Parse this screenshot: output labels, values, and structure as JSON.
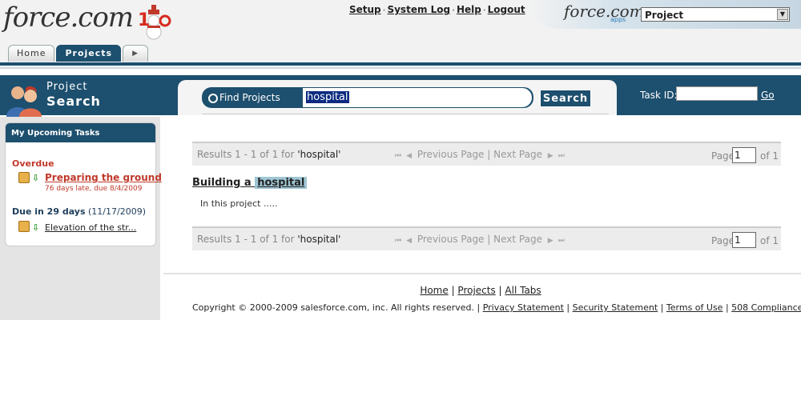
{
  "brand": {
    "logo_text": "force.com",
    "logo_suffix": "10",
    "app_logo_text": "force.com",
    "app_logo_sub": "apps"
  },
  "tabs": [
    {
      "label": "Home"
    },
    {
      "label": "Projects"
    }
  ],
  "top_links": {
    "setup": "Setup",
    "system_log": "System Log",
    "help": "Help",
    "logout": "Logout"
  },
  "app_selector": {
    "selected": "Project"
  },
  "project_search": {
    "title_line1": "Project",
    "title_line2": "Search",
    "find_label": "Find Projects",
    "query": "hospital",
    "search_button": "Search"
  },
  "task_id": {
    "label": "Task ID:",
    "value": "",
    "go_label": "Go"
  },
  "upcoming_tasks": {
    "header": "My Upcoming Tasks",
    "overdue_label": "Overdue",
    "overdue_task": {
      "name": "Preparing the ground",
      "detail": "76 days late, due 8/4/2009"
    },
    "due_label_bold": "Due in 29 days",
    "due_label_date": "(11/17/2009)",
    "due_task": {
      "name": "Elevation of the str..."
    }
  },
  "results": {
    "summary_prefix": "Results 1 - 1 of 1  for ",
    "summary_query": "'hospital'",
    "previous_page": "Previous Page",
    "separator": "|",
    "next_page": "Next Page",
    "page_label": "Page",
    "page_value": "1",
    "page_of": "of 1",
    "items": [
      {
        "title_prefix": "Building a ",
        "title_highlight": "hospital",
        "snippet": "In this project ....."
      }
    ]
  },
  "footer": {
    "links": [
      "Home",
      "Projects",
      "All Tabs"
    ],
    "copyright": "Copyright © 2000-2009 salesforce.com, inc. All rights reserved. |",
    "legal_links": [
      "Privacy Statement",
      "Security Statement",
      "Terms of Use",
      "508 Compliance"
    ]
  },
  "colors": {
    "header_blue": "#1d4f6e",
    "overdue_red": "#c0392b",
    "highlight": "#9fc6d4"
  }
}
